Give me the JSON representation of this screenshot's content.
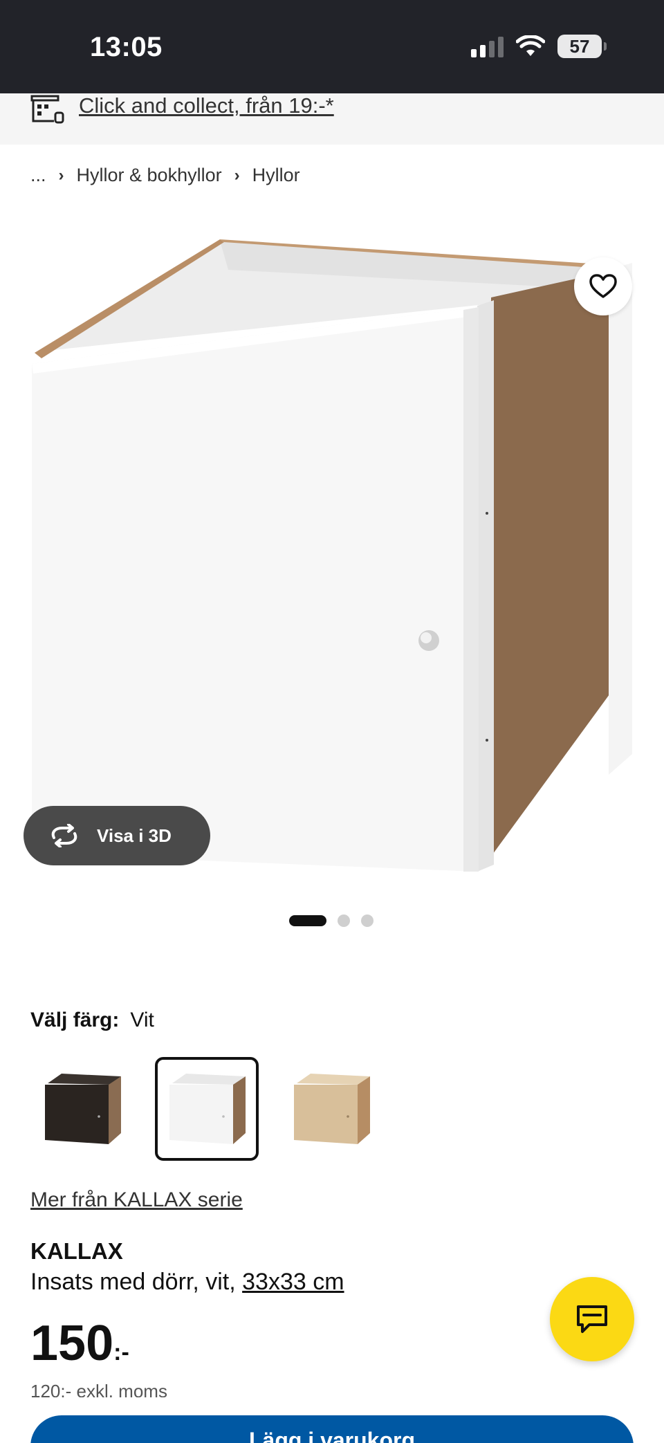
{
  "status_bar": {
    "time": "13:05",
    "battery": "57"
  },
  "collect_bar": {
    "text": "Click and collect, från 19:-*"
  },
  "breadcrumb": {
    "ellipsis": "...",
    "items": [
      "Hyllor & bokhyllor",
      "Hyllor"
    ]
  },
  "product_image": {
    "view3d_label": "Visa i 3D",
    "slides": 3,
    "active_slide": 1
  },
  "color": {
    "label": "Välj färg:",
    "selected": "Vit",
    "options": [
      {
        "name": "svartbrun",
        "hex": "#2a2420"
      },
      {
        "name": "vit",
        "hex": "#f2f2f2"
      },
      {
        "name": "ekeffekt",
        "hex": "#d8bf9a"
      }
    ]
  },
  "series_link": "Mer från KALLAX serie",
  "product": {
    "name": "KALLAX",
    "desc_prefix": "Insats med dörr, vit, ",
    "size": "33x33 cm"
  },
  "price": {
    "value": "150",
    "suffix": ":-",
    "exvat": "120:- exkl. moms"
  },
  "cta": {
    "label": "Lägg i varukorg"
  },
  "colors": {
    "brand_blue": "#0058a3",
    "chat_yellow": "#fbd914",
    "status_bg": "#222329"
  }
}
